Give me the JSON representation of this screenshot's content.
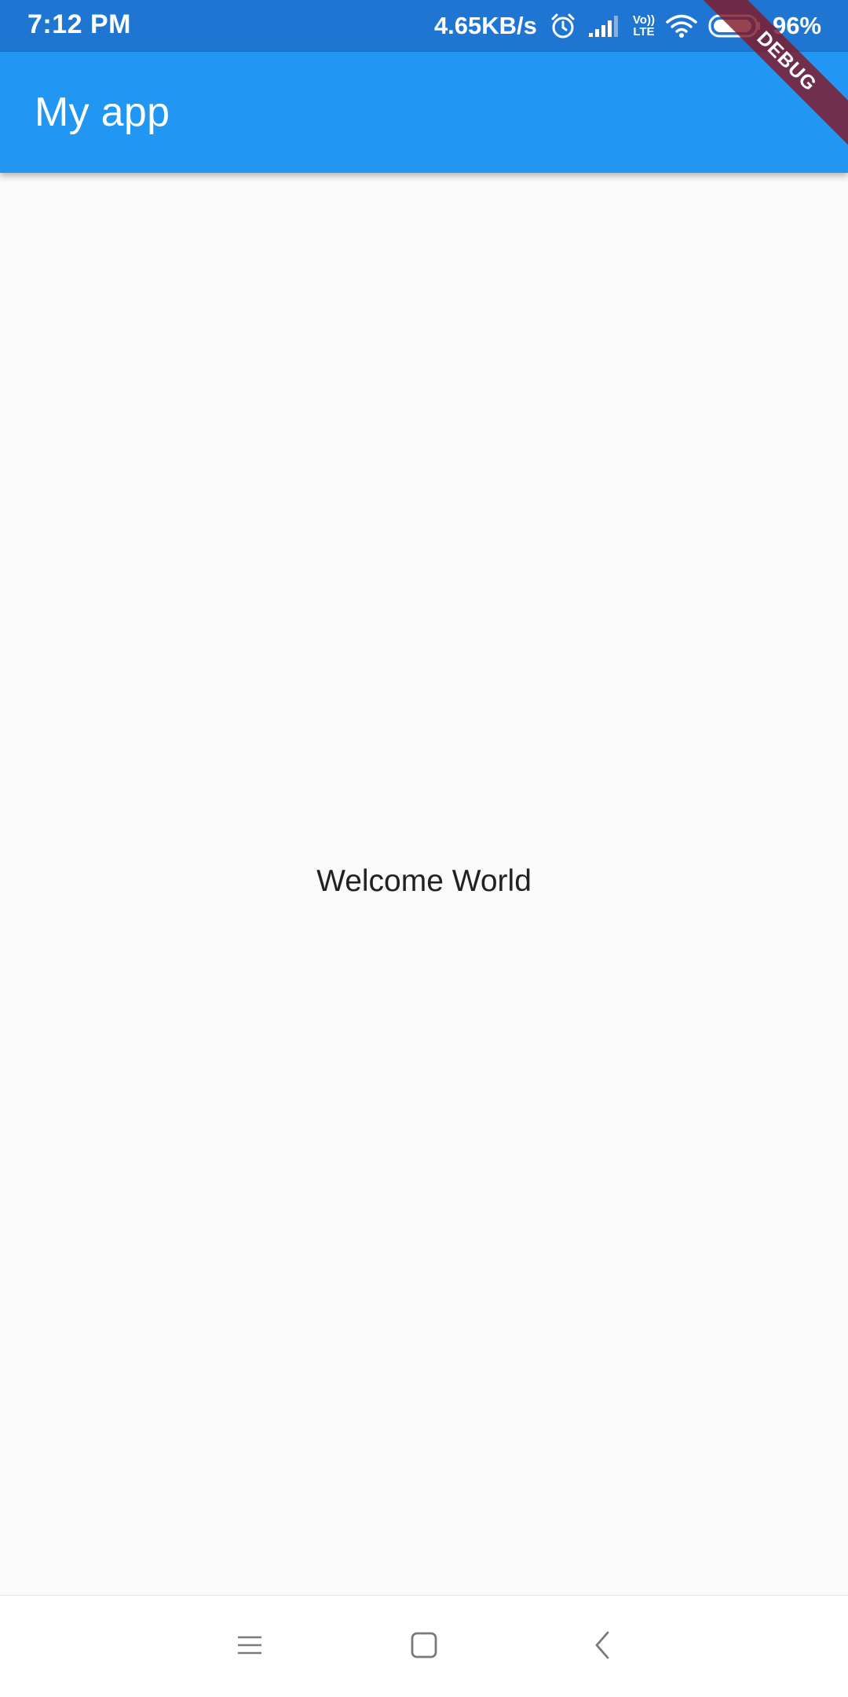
{
  "status_bar": {
    "time": "7:12 PM",
    "net_speed": "4.65KB/s",
    "volte_top": "Vo))",
    "volte_bottom": "LTE",
    "battery_percent": "96%",
    "icons": [
      "alarm-icon",
      "signal-icon",
      "volte-icon",
      "wifi-icon",
      "battery-icon"
    ],
    "battery_level": 0.96
  },
  "app_bar": {
    "title": "My app"
  },
  "debug_banner": {
    "label": "DEBUG"
  },
  "body": {
    "text": "Welcome World"
  },
  "nav_bar": {
    "icons": [
      "menu-icon",
      "home-icon",
      "back-icon"
    ]
  },
  "colors": {
    "status_bar": "#1e76d2",
    "app_bar": "#2196f3",
    "background": "#fafafa",
    "debug_banner": "#801828"
  }
}
